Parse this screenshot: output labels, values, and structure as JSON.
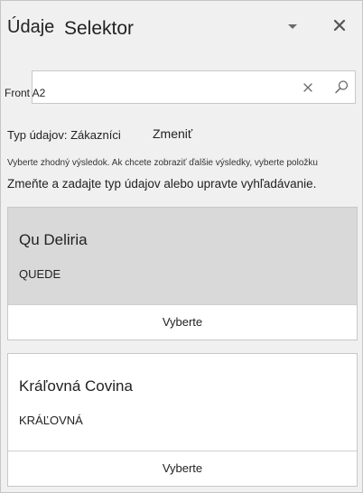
{
  "header": {
    "title": "Údaje",
    "subtitle": "Selektor",
    "collapse_icon": "chevron-down-icon",
    "close_icon": "close-icon"
  },
  "search": {
    "value": "Front A2",
    "clear_icon": "clear-icon",
    "search_icon": "search-icon"
  },
  "data_type": {
    "label": "Typ údajov: Zákazníci",
    "change_label": "Zmeniť"
  },
  "hint_text": "Vyberte zhodný výsledok. Ak chcete zobraziť ďalšie výsledky, vyberte položku",
  "description": "Zmeňte a zadajte typ údajov alebo upravte vyhľadávanie.",
  "results": [
    {
      "name": "Qu Deliria",
      "code": "QUEDE",
      "select_label": "Vyberte"
    },
    {
      "name": "Kráľovná Covina",
      "code": "KRÁĽOVNÁ",
      "select_label": "Vyberte"
    }
  ],
  "colors": {
    "pane_background": "#f0f0f0",
    "selected_card": "#d9d9d9",
    "card_background": "#ffffff",
    "border": "#c8c8c8",
    "icon": "#6a6a6a"
  }
}
